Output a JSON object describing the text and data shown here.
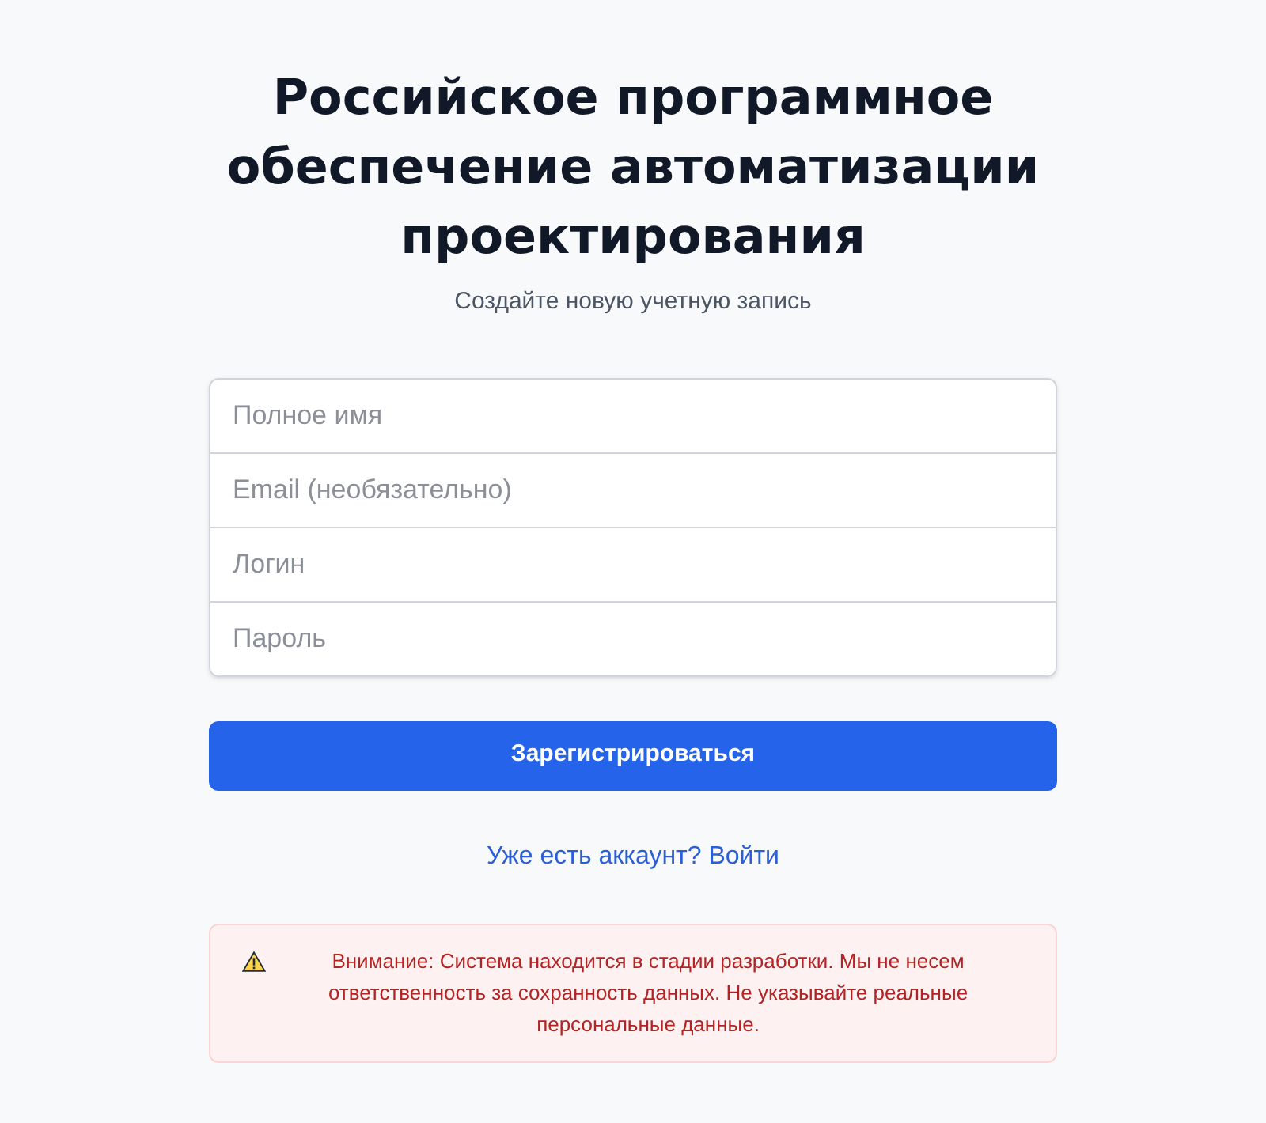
{
  "title": "Российское программное обеспечение автоматизации проектирования",
  "subtitle": "Создайте новую учетную запись",
  "fields": [
    {
      "placeholder": "Полное имя"
    },
    {
      "placeholder": "Email (необязательно)"
    },
    {
      "placeholder": "Логин"
    },
    {
      "placeholder": "Пароль"
    }
  ],
  "submit_button": "Зарегистрироваться",
  "login_link": "Уже есть аккаунт? Войти",
  "warning": "Внимание: Система находится в стадии разработки. Мы не несем ответственность за сохранность данных. Не указывайте реальные персональные данные."
}
